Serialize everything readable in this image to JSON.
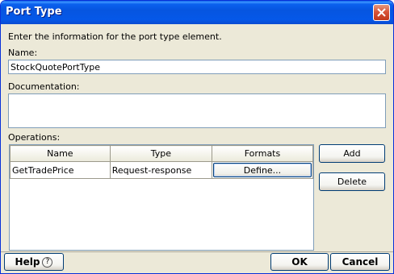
{
  "window": {
    "title": "Port Type"
  },
  "form": {
    "instructions": "Enter the information for the port type element.",
    "name_label": "Name:",
    "name_value": "StockQuotePortType",
    "documentation_label": "Documentation:",
    "documentation_value": "",
    "operations_label": "Operations:"
  },
  "operations": {
    "columns": [
      "Name",
      "Type",
      "Formats"
    ],
    "rows": [
      {
        "name": "GetTradePrice",
        "type": "Request-response",
        "formats_button": "Define..."
      }
    ]
  },
  "side_buttons": {
    "add": "Add",
    "delete": "Delete"
  },
  "footer": {
    "help": "Help",
    "ok": "OK",
    "cancel": "Cancel"
  },
  "colors": {
    "titlebar": "#0558e8",
    "dialog_bg": "#ece9d8",
    "field_border": "#7f9db9"
  },
  "icons": {
    "close": "close-icon",
    "help": "help-question-icon"
  }
}
